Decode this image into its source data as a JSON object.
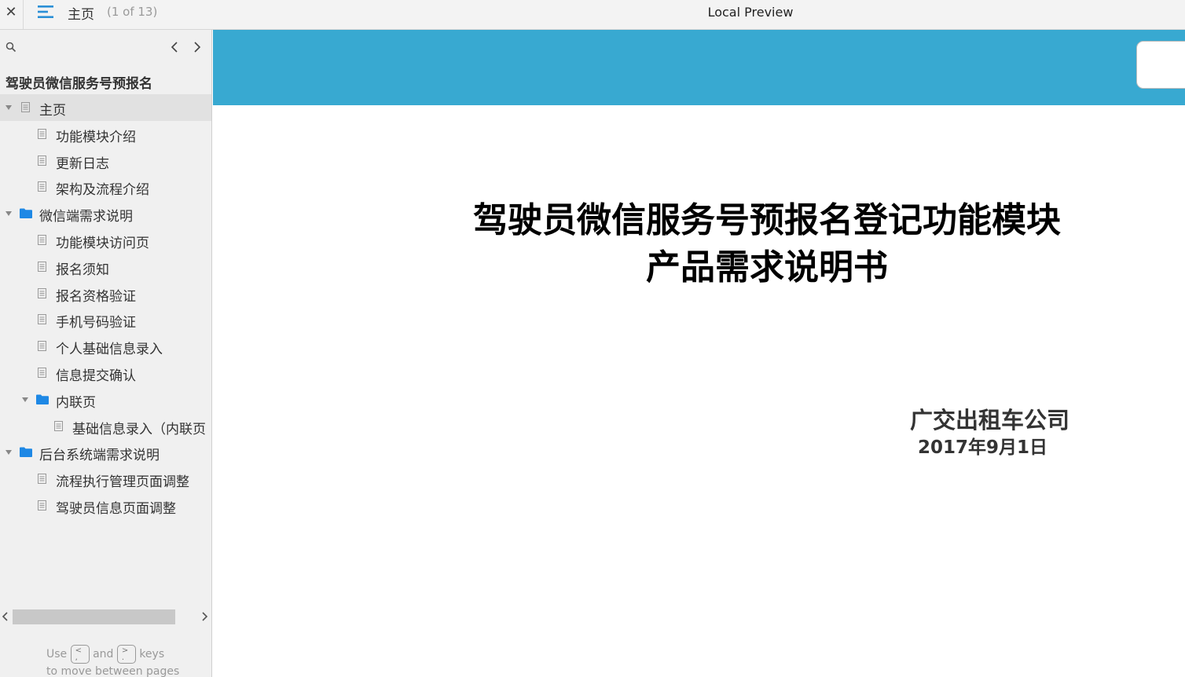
{
  "topbar": {
    "close_label": "✕",
    "current_page": "主页",
    "page_counter": "(1 of 13)",
    "app_title": "Local Preview"
  },
  "sidebar": {
    "project_title": "驾驶员微信服务号预报名",
    "tree": [
      {
        "label": "主页",
        "type": "page",
        "level": 0,
        "expanded": true,
        "selected": true
      },
      {
        "label": "功能模块介绍",
        "type": "page",
        "level": 1
      },
      {
        "label": "更新日志",
        "type": "page",
        "level": 1
      },
      {
        "label": "架构及流程介绍",
        "type": "page",
        "level": 1
      },
      {
        "label": "微信端需求说明",
        "type": "folder",
        "level": 0,
        "expanded": true
      },
      {
        "label": "功能模块访问页",
        "type": "page",
        "level": 1
      },
      {
        "label": "报名须知",
        "type": "page",
        "level": 1
      },
      {
        "label": "报名资格验证",
        "type": "page",
        "level": 1
      },
      {
        "label": "手机号码验证",
        "type": "page",
        "level": 1
      },
      {
        "label": "个人基础信息录入",
        "type": "page",
        "level": 1
      },
      {
        "label": "信息提交确认",
        "type": "page",
        "level": 1
      },
      {
        "label": "内联页",
        "type": "folder",
        "level": 1,
        "expanded": true
      },
      {
        "label": "基础信息录入（内联页",
        "type": "page",
        "level": 2
      },
      {
        "label": "后台系统端需求说明",
        "type": "folder",
        "level": 0,
        "expanded": true
      },
      {
        "label": "流程执行管理页面调整",
        "type": "page",
        "level": 1
      },
      {
        "label": "驾驶员信息页面调整",
        "type": "page",
        "level": 1
      }
    ],
    "hint": {
      "use": "Use",
      "key_prev": "<\n,",
      "and": "and",
      "key_next": ">\n.",
      "keys": "keys",
      "line2": "to move between pages"
    }
  },
  "document": {
    "title_line1": "驾驶员微信服务号预报名登记功能模块",
    "title_line2": "产品需求说明书",
    "company": "广交出租车公司",
    "date": "2017年9月1日"
  },
  "colors": {
    "banner": "#38a9d1",
    "folder_icon": "#1e88e5",
    "menu_icon": "#2a8fd6"
  }
}
